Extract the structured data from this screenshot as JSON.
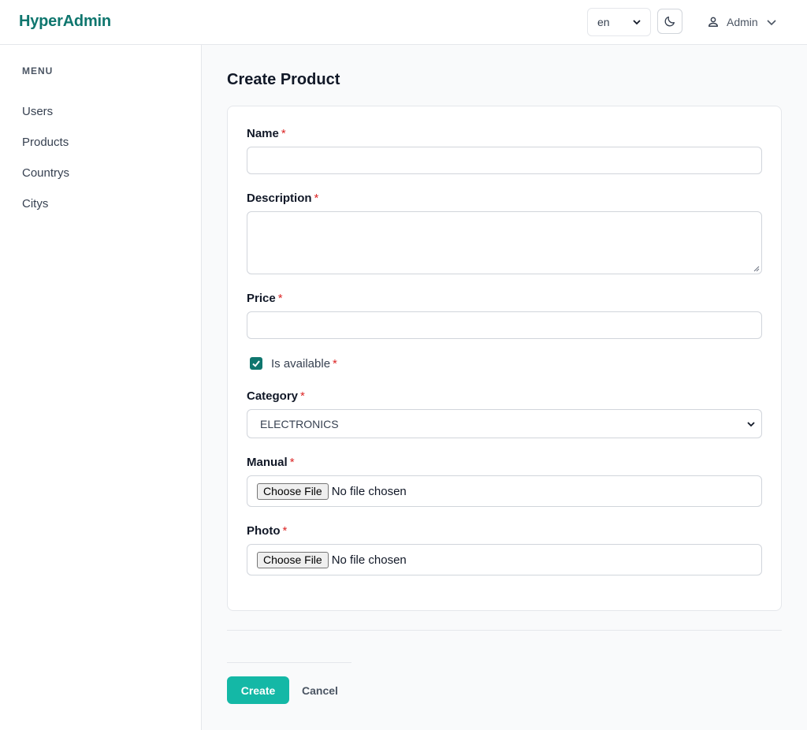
{
  "app": {
    "brand": "HyperAdmin"
  },
  "header": {
    "language": "en",
    "user_name": "Admin"
  },
  "sidebar": {
    "menu_title": "MENU",
    "items": [
      {
        "label": "Users"
      },
      {
        "label": "Products"
      },
      {
        "label": "Countrys"
      },
      {
        "label": "Citys"
      }
    ]
  },
  "page": {
    "title": "Create Product"
  },
  "form": {
    "name": {
      "label": "Name",
      "required": "*",
      "value": ""
    },
    "description": {
      "label": "Description",
      "required": "*",
      "value": ""
    },
    "price": {
      "label": "Price",
      "required": "*",
      "value": ""
    },
    "is_available": {
      "label": "Is available",
      "required": "*",
      "checked": true
    },
    "category": {
      "label": "Category",
      "required": "*",
      "selected": "ELECTRONICS"
    },
    "manual": {
      "label": "Manual",
      "required": "*",
      "button": "Choose File",
      "status": "No file chosen"
    },
    "photo": {
      "label": "Photo",
      "required": "*",
      "button": "Choose File",
      "status": "No file chosen"
    }
  },
  "actions": {
    "create": "Create",
    "cancel": "Cancel"
  },
  "colors": {
    "brand": "#0f766e",
    "primary_button": "#14b8a6",
    "required": "#dc2626"
  }
}
